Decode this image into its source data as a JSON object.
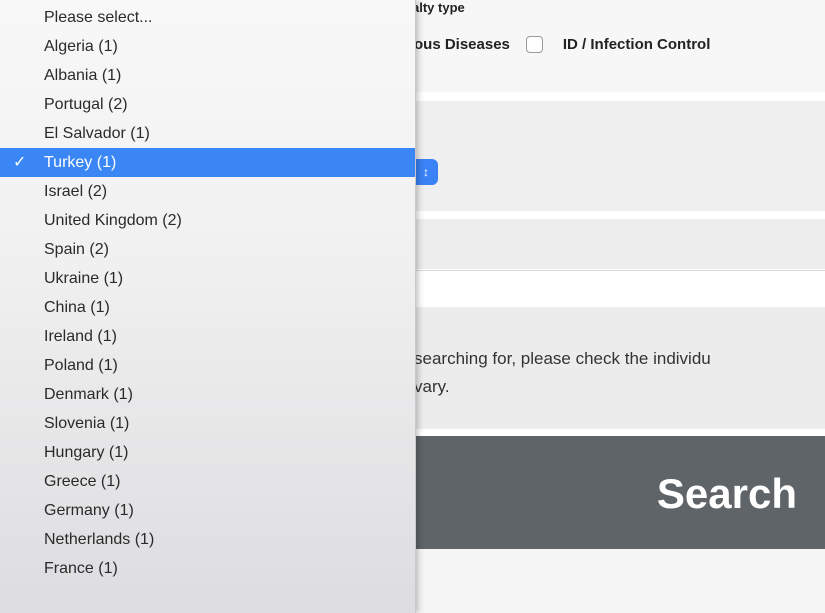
{
  "form": {
    "specialty_heading": "alty type",
    "checkbox_1_label": "ous Diseases",
    "checkbox_2_label": "ID / Infection Control",
    "note_line_1": "searching for, please check the individu",
    "note_line_2": "vary.",
    "search_button_label": "Search"
  },
  "dropdown": {
    "check_glyph": "✓",
    "selected_index": 5,
    "options": [
      "Please select...",
      "Algeria (1)",
      "Albania (1)",
      "Portugal (2)",
      "El Salvador (1)",
      "Turkey (1)",
      "Israel (2)",
      "United Kingdom (2)",
      "Spain (2)",
      "Ukraine (1)",
      "China (1)",
      "Ireland (1)",
      "Poland (1)",
      "Denmark (1)",
      "Slovenia (1)",
      "Hungary (1)",
      "Greece (1)",
      "Germany (1)",
      "Netherlands (1)",
      "France (1)"
    ]
  },
  "colors": {
    "selection_blue": "#3a86f5",
    "search_bar": "#5f6469"
  },
  "icons": {
    "select_arrow": "chevron-updown-icon",
    "check": "checkmark-icon"
  }
}
